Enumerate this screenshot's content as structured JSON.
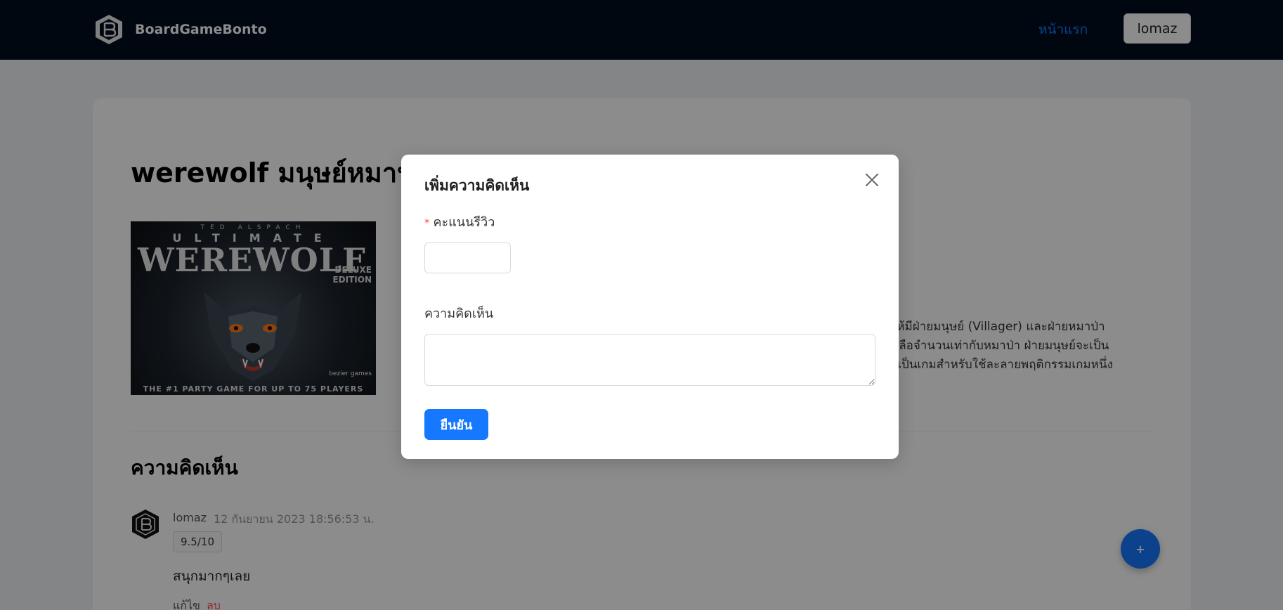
{
  "header": {
    "brand_name": "BoardGameBonto",
    "nav_home": "หน้าแรก",
    "user_button": "lomaz"
  },
  "game": {
    "title": "werewolf มนุษย์หมาป่า",
    "cover": {
      "top_text": "TED ALSPACH",
      "sub_text": "ULTIMATE",
      "title_text": "WEREWOLF",
      "edition_line1": "DELUXE",
      "edition_line2": "EDITION",
      "publisher": "bezier games",
      "tagline": "THE #1 PARTY GAME FOR UP TO 75 PLAYERS"
    },
    "description_lines": [
      "ให้มีฝ่ายมนุษย์ (Villager) และฝ่ายหมาป่า",
      "หลือจำนวนเท่ากับหมาป่า ฝ่ายมนุษย์จะเป็น",
      "ะเป็นเกมสำหรับใช้ละลายพฤติกรรมเกมหนึ่ง"
    ]
  },
  "comments": {
    "section_title": "ความคิดเห็น",
    "items": [
      {
        "author": "lomaz",
        "date": "12 กันยายน 2023 18:56:53 น.",
        "score": "9.5/10",
        "text": "สนุกมากๆเลย",
        "edit_label": "แก้ไข",
        "delete_label": "ลบ"
      }
    ]
  },
  "fab": {
    "label": "+"
  },
  "modal": {
    "title": "เพิ่มความคิดเห็น",
    "score_label": "คะแนนรีวิว",
    "required_mark": "*",
    "score_value": "",
    "comment_label": "ความคิดเห็น",
    "comment_value": "",
    "confirm_label": "ยืนยัน"
  },
  "colors": {
    "navbar_bg": "#000d1f",
    "primary": "#1677ff",
    "danger": "#ff4d4f",
    "overlay": "rgba(0,0,0,0.45)"
  }
}
